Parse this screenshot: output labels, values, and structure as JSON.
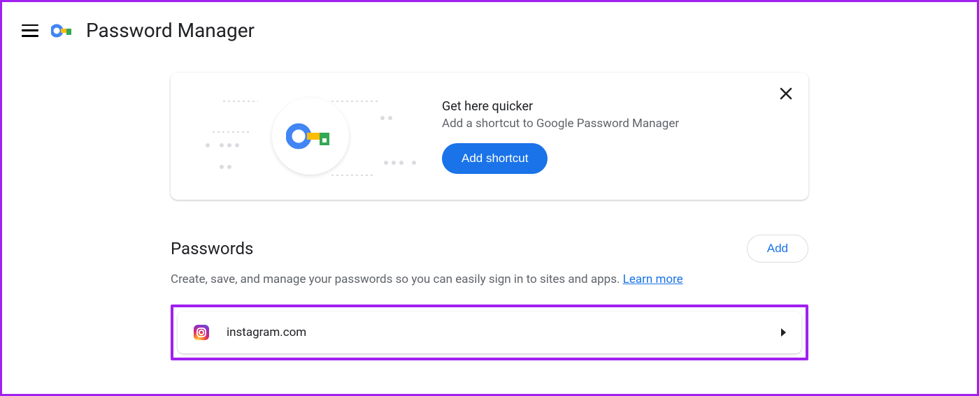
{
  "header": {
    "title": "Password Manager"
  },
  "promo": {
    "heading": "Get here quicker",
    "description": "Add a shortcut to Google Password Manager",
    "button_label": "Add shortcut"
  },
  "passwords_section": {
    "title": "Passwords",
    "add_button": "Add",
    "description": "Create, save, and manage your passwords so you can easily sign in to sites and apps. ",
    "learn_more": "Learn more"
  },
  "password_entries": [
    {
      "site": "instagram.com",
      "icon_colors": {
        "gradient": true
      }
    }
  ],
  "colors": {
    "accent": "#1a73e8",
    "highlight": "#a020f0",
    "text_primary": "#202124",
    "text_secondary": "#5f6368"
  }
}
